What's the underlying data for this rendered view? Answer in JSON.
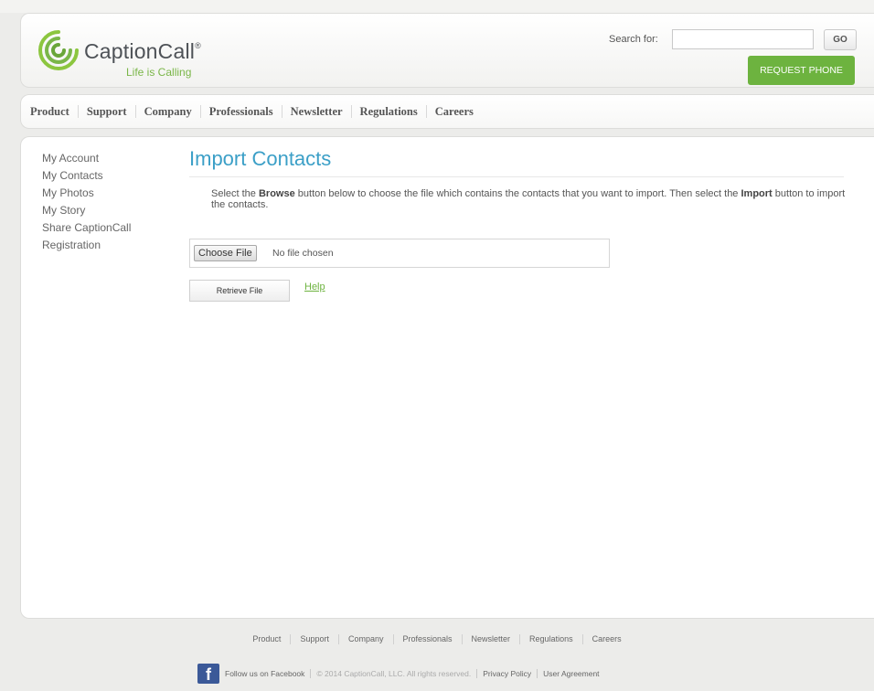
{
  "brand": {
    "name": "CaptionCall",
    "trademark": "®",
    "tagline": "Life is Calling",
    "colors": {
      "green": "#6db33f",
      "title_blue": "#3b9fc7",
      "facebook_blue": "#3b5998"
    }
  },
  "search": {
    "label": "Search for:",
    "value": "",
    "go_label": "GO"
  },
  "header": {
    "request_phone_label": "REQUEST PHONE"
  },
  "nav": {
    "items": [
      "Product",
      "Support",
      "Company",
      "Professionals",
      "Newsletter",
      "Regulations",
      "Careers"
    ]
  },
  "sidebar": {
    "items": [
      "My Account",
      "My Contacts",
      "My Photos",
      "My Story",
      "Share CaptionCall",
      "Registration"
    ]
  },
  "main": {
    "title": "Import Contacts",
    "instructions": {
      "part1": "Select the ",
      "bold1": "Browse",
      "part2": " button below to choose the file which contains the contacts that you want to import. Then select the ",
      "bold2": "Import",
      "part3": " button to import the contacts."
    },
    "file_input": {
      "button_label": "Choose File",
      "status": "No file chosen"
    },
    "retrieve_label": "Retrieve File",
    "help_label": "Help"
  },
  "footer": {
    "nav": [
      "Product",
      "Support",
      "Company",
      "Professionals",
      "Newsletter",
      "Regulations",
      "Careers"
    ],
    "facebook_icon_letter": "f",
    "follow": "Follow us on Facebook",
    "copyright": "© 2014 CaptionCall, LLC. All rights reserved.",
    "privacy": "Privacy Policy",
    "agreement": "User Agreement"
  }
}
